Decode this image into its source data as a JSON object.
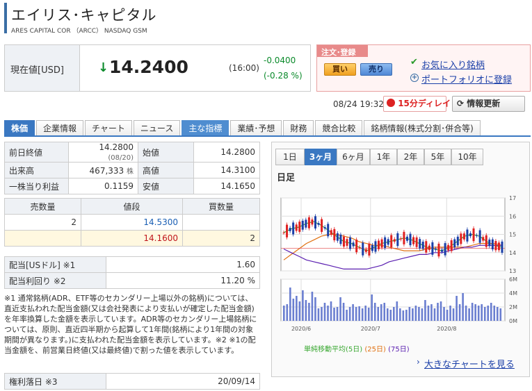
{
  "header": {
    "company_name": "エイリス･キャピタル",
    "ticker_line": "ARES CAPITAL COR （ARCC） NASDAQ GSM"
  },
  "price": {
    "label": "現在値[USD]",
    "arrow": "↓",
    "value": "14.2400",
    "time": "(16:00)",
    "change_abs": "-0.0400",
    "change_pct": "(-0.28 %)",
    "change_color": "#0a8a2a"
  },
  "order": {
    "title": "注文･登録",
    "buy": "買い",
    "sell": "売り",
    "favorite": "お気に入り銘柄",
    "portfolio": "ポートフォリオに登録"
  },
  "status": {
    "updated": "08/24 19:32",
    "delay": "15分ディレイ",
    "refresh": "情報更新"
  },
  "tabs": [
    {
      "label": "株価"
    },
    {
      "label": "企業情報"
    },
    {
      "label": "チャート"
    },
    {
      "label": "ニュース"
    },
    {
      "label": "主な指標"
    },
    {
      "label": "業績･予想"
    },
    {
      "label": "財務"
    },
    {
      "label": "競合比較"
    },
    {
      "label": "銘柄情報(株式分割･併合等)"
    }
  ],
  "quote": {
    "prev_close_label": "前日終値",
    "prev_close": "14.2800",
    "prev_close_date": "(08/20)",
    "open_label": "始値",
    "open": "14.2800",
    "volume_label": "出来高",
    "volume": "467,333",
    "volume_unit": "株",
    "high_label": "高値",
    "high": "14.3100",
    "eps_label": "一株当り利益",
    "eps": "0.1159",
    "low_label": "安値",
    "low": "14.1650"
  },
  "board": {
    "sell_qty_label": "売数量",
    "price_label": "値段",
    "buy_qty_label": "買数量",
    "row1_sell_qty": "2",
    "row1_price": "14.5300",
    "row2_price": "14.1600",
    "row2_buy_qty": "2"
  },
  "dividend": {
    "div_label": "配当[USドル] ※1",
    "div_value": "1.60",
    "yield_label": "配当利回り ※2",
    "yield_value": "11.20 %"
  },
  "note": "※1 通常銘柄(ADR、ETF等のセカンダリー上場以外の銘柄)については、直近支払われた配当金額(又は会社発表により支払いが確定した配当金額)を年率換算した金額を表示しています。ADR等のセカンダリー上場銘柄については、原則、直近四半期から起算して1年間(銘柄により1年間の対象期間が異なります。)に支払われた配当金額を表示しています。※2 ※1の配当金額を、前営業日終値(又は最終値)で割った値を表示しています。",
  "ex_rights": {
    "label": "権利落日 ※3",
    "value": "20/09/14"
  },
  "chart_panel": {
    "ranges": [
      "1日",
      "3ヶ月",
      "6ヶ月",
      "1年",
      "2年",
      "5年",
      "10年"
    ],
    "active_range": "3ヶ月",
    "subtitle": "日足",
    "ma_prefix": "単純移動平均",
    "ma5": "(5日)",
    "ma25": "(25日)",
    "ma75": "(75日)",
    "big_chart_link": "大きなチャートを見る",
    "colors": {
      "up": "#e02020",
      "down": "#1a3fa8",
      "ma5": "#3aa832",
      "ma25": "#e07010",
      "ma75": "#5a1eb0",
      "volume": "#6a7ed0"
    }
  },
  "chart_data": [
    {
      "type": "line",
      "title": "",
      "xlabel": "",
      "ylabel": "",
      "ylim": [
        13,
        17
      ],
      "y_ticks": [
        "13",
        "14",
        "15",
        "16",
        "17"
      ],
      "x_ticks": [
        "2020/6",
        "2020/7",
        "2020/8"
      ],
      "series": [
        {
          "name": "(5日)",
          "values": [
            15.1,
            15.3,
            15.4,
            15.6,
            15.7,
            15.5,
            15.2,
            14.9,
            14.6,
            14.5,
            14.3,
            14.1,
            14.3,
            14.5,
            14.6,
            14.7,
            14.8,
            14.7,
            14.5,
            14.3,
            14.2,
            14.1,
            14.3,
            14.6,
            14.9,
            15.0,
            14.9,
            14.6,
            14.4,
            14.3
          ]
        },
        {
          "name": "(25日)",
          "values": [
            13.6,
            13.9,
            14.2,
            14.5,
            14.7,
            14.9,
            15.0,
            15.0,
            14.9,
            14.8,
            14.6,
            14.5,
            14.4,
            14.4,
            14.3,
            14.2,
            14.1,
            14.1,
            14.1,
            14.2,
            14.3,
            14.3,
            14.3,
            14.3,
            14.3,
            14.4,
            14.5,
            14.5,
            14.5,
            14.4
          ]
        },
        {
          "name": "(75日)",
          "values": [
            14.2,
            14.0,
            13.8,
            13.6,
            13.5,
            13.4,
            13.3,
            13.2,
            13.1,
            13.1,
            13.1,
            13.1,
            13.2,
            13.3,
            13.5,
            13.6,
            13.7,
            13.8,
            13.9,
            13.9,
            14.0,
            14.0,
            14.1,
            14.2,
            14.3,
            14.3,
            14.4,
            14.4,
            14.4,
            14.4
          ]
        }
      ]
    },
    {
      "type": "bar",
      "title": "",
      "ylim": [
        0,
        6
      ],
      "y_ticks": [
        "0M",
        "2M",
        "4M",
        "6M"
      ],
      "x_ticks": [
        "2020/6",
        "2020/7",
        "2020/8"
      ],
      "series": [
        {
          "name": "",
          "values": [
            2.2,
            2.4,
            4.8,
            3.2,
            3.6,
            2.8,
            4.4,
            3.0,
            2.6,
            4.2,
            3.4,
            1.8,
            2.0,
            2.6,
            2.2,
            2.8,
            1.9,
            2.0,
            3.4,
            2.6,
            1.6,
            2.0,
            2.4,
            2.0,
            2.1,
            1.8,
            2.2,
            1.9,
            3.8,
            2.6,
            2.0,
            2.4,
            2.6,
            1.8,
            1.6,
            2.0,
            2.8,
            1.8,
            1.5,
            1.6,
            2.0,
            1.8,
            2.2,
            2.0,
            1.8,
            3.0,
            2.2,
            2.4,
            1.8,
            2.6,
            2.8,
            2.0,
            1.6,
            2.2,
            1.8,
            3.6,
            2.4,
            4.0,
            2.2,
            1.8,
            2.6,
            2.4,
            2.2,
            2.4,
            2.0,
            2.2,
            2.6,
            2.2,
            2.0,
            1.8
          ]
        }
      ]
    }
  ]
}
